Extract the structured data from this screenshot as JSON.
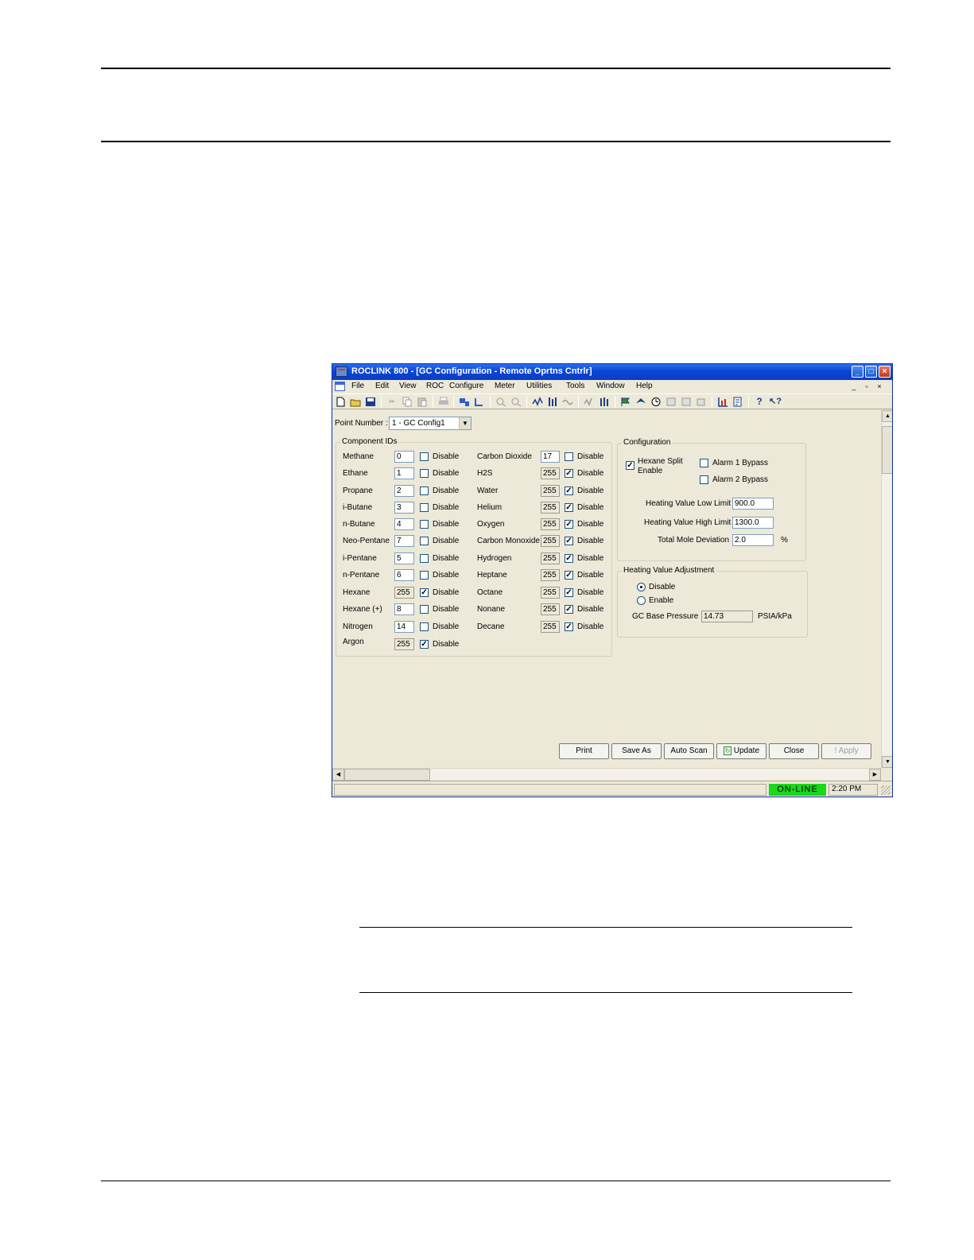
{
  "window": {
    "title": "ROCLINK 800 - [GC Configuration - Remote Oprtns Cntrlr]",
    "buttons": [
      "_",
      "□",
      "×"
    ]
  },
  "menubar": {
    "items": [
      "File",
      "Edit",
      "View",
      "ROC",
      "Configure",
      "Meter",
      "Utilities",
      "Tools",
      "Window",
      "Help"
    ],
    "mdi_buttons": [
      "_",
      "▫",
      "×"
    ]
  },
  "point_number": {
    "label": "Point Number :",
    "value": "1 - GC Config1"
  },
  "component_ids": {
    "title": "Component IDs",
    "disable_label": "Disable",
    "left": [
      {
        "name": "Methane",
        "id": "0",
        "disabled": false
      },
      {
        "name": "Ethane",
        "id": "1",
        "disabled": false
      },
      {
        "name": "Propane",
        "id": "2",
        "disabled": false
      },
      {
        "name": "i-Butane",
        "id": "3",
        "disabled": false
      },
      {
        "name": "n-Butane",
        "id": "4",
        "disabled": false
      },
      {
        "name": "Neo-Pentane",
        "id": "7",
        "disabled": false
      },
      {
        "name": "i-Pentane",
        "id": "5",
        "disabled": false
      },
      {
        "name": "n-Pentane",
        "id": "6",
        "disabled": false
      },
      {
        "name": "Hexane",
        "id": "255",
        "disabled": true
      },
      {
        "name": "Hexane (+)",
        "id": "8",
        "disabled": false
      },
      {
        "name": "Nitrogen",
        "id": "14",
        "disabled": false
      },
      {
        "name": "Argon",
        "id": "255",
        "disabled": true
      }
    ],
    "right": [
      {
        "name": "Carbon Dioxide",
        "id": "17",
        "disabled": false
      },
      {
        "name": "H2S",
        "id": "255",
        "disabled": true
      },
      {
        "name": "Water",
        "id": "255",
        "disabled": true
      },
      {
        "name": "Helium",
        "id": "255",
        "disabled": true
      },
      {
        "name": "Oxygen",
        "id": "255",
        "disabled": true
      },
      {
        "name": "Carbon Monoxide",
        "id": "255",
        "disabled": true
      },
      {
        "name": "Hydrogen",
        "id": "255",
        "disabled": true
      },
      {
        "name": "Heptane",
        "id": "255",
        "disabled": true
      },
      {
        "name": "Octane",
        "id": "255",
        "disabled": true
      },
      {
        "name": "Nonane",
        "id": "255",
        "disabled": true
      },
      {
        "name": "Decane",
        "id": "255",
        "disabled": true
      }
    ]
  },
  "configuration": {
    "title": "Configuration",
    "hexane_split_line1": "Hexane Split",
    "hexane_split_line2": "Enable",
    "hexane_split_checked": true,
    "alarm1_label": "Alarm 1 Bypass",
    "alarm2_label": "Alarm 2 Bypass",
    "hv_low_label": "Heating Value Low Limit",
    "hv_low_value": "900.0",
    "hv_high_label": "Heating Value High Limit",
    "hv_high_value": "1300.0",
    "mole_dev_label": "Total Mole Deviation",
    "mole_dev_value": "2.0",
    "mole_dev_unit": "%"
  },
  "heating_value_adjustment": {
    "title": "Heating Value Adjustment",
    "disable_label": "Disable",
    "enable_label": "Enable",
    "selected": "Disable",
    "base_pressure_label": "GC Base Pressure",
    "base_pressure_value": "14.73",
    "base_pressure_unit": "PSIA/kPa"
  },
  "buttons": {
    "print": "Print",
    "save_as": "Save As",
    "auto_scan": "Auto Scan",
    "update": "Update",
    "close": "Close",
    "apply": "Apply"
  },
  "status": {
    "online": "ON-LINE",
    "time": "2:20 PM"
  },
  "colors": {
    "titlebar": "#0a46d6",
    "window_bg": "#ece9d8",
    "online": "#18d818"
  }
}
